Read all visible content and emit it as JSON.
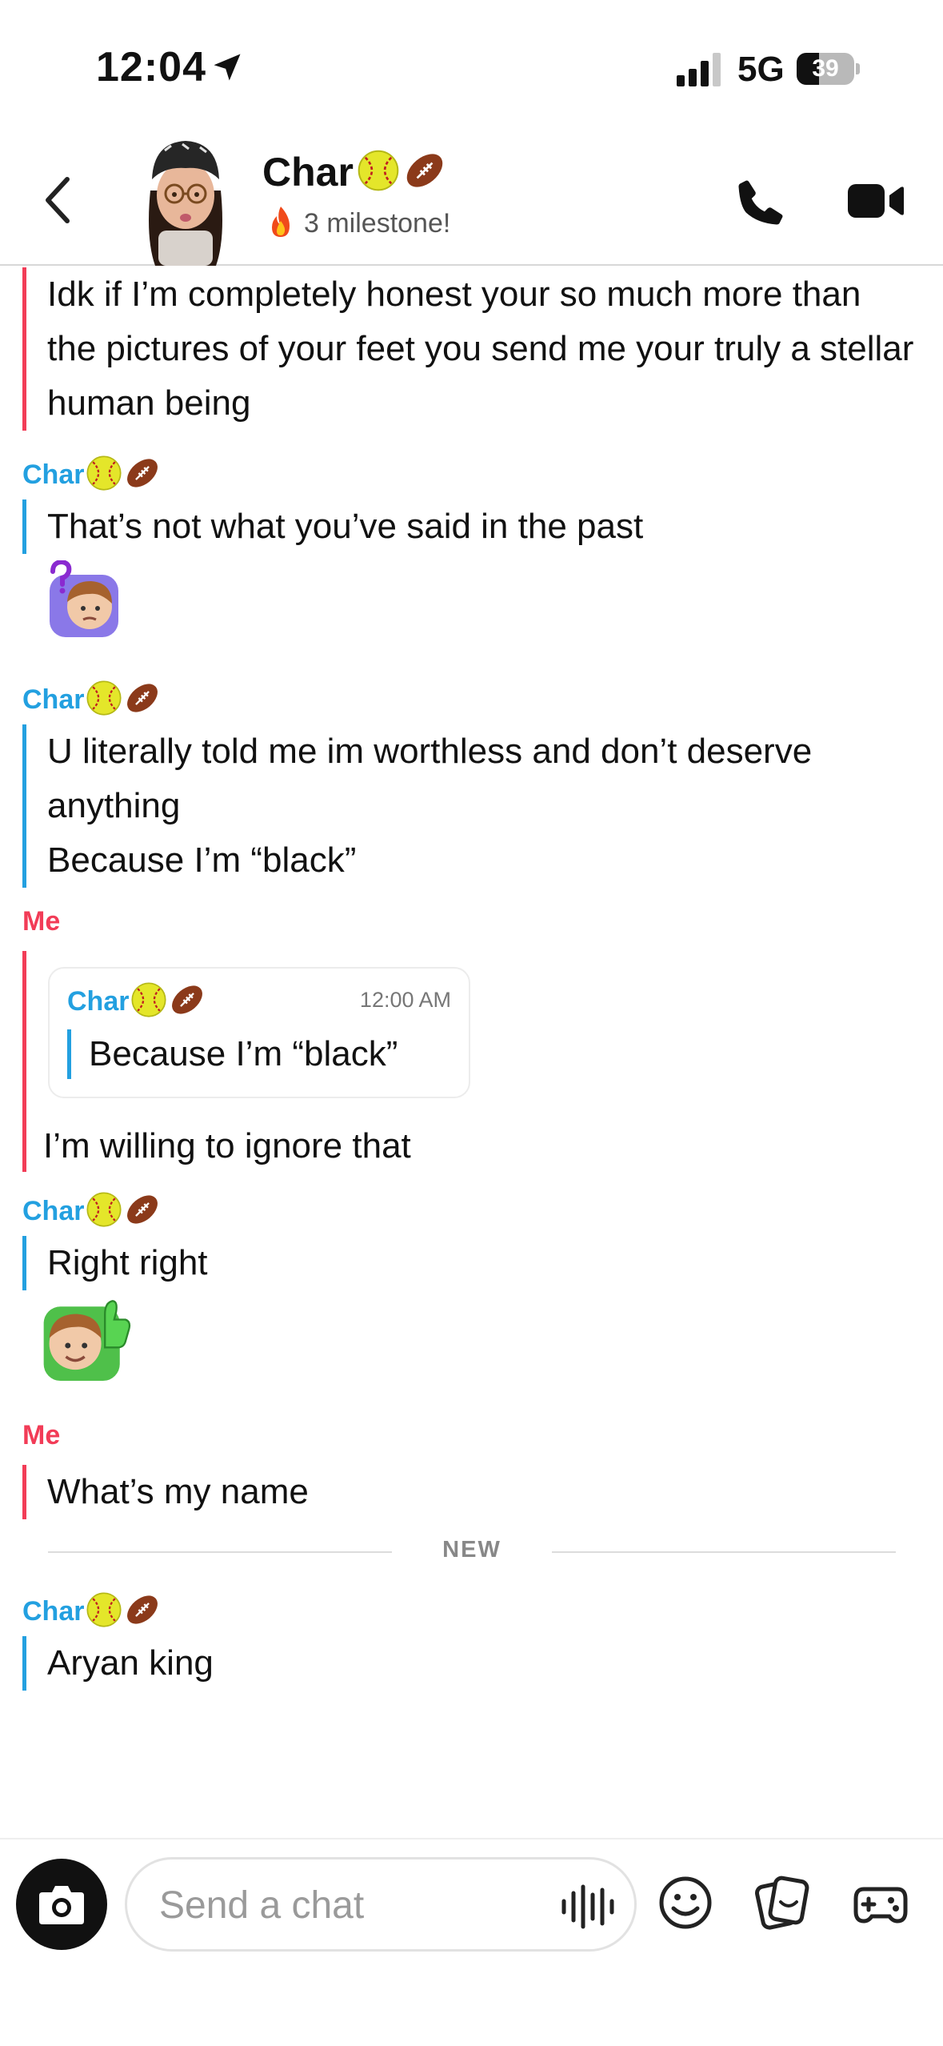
{
  "status_bar": {
    "time": "12:04",
    "network": "5G",
    "battery": "39",
    "battery_level": 0.39
  },
  "header": {
    "name": "Char",
    "name_emojis": [
      "softball-icon",
      "football-icon"
    ],
    "streak": "3 milestone!"
  },
  "messages": [
    {
      "type": "text",
      "from": "me",
      "sender": "",
      "text": "Idk if I’m completely honest your so much more than the pictures of your feet you send me your truly a stellar human being"
    },
    {
      "type": "text",
      "from": "them",
      "sender": "Char",
      "text": "That’s not what you’ve said in the past"
    },
    {
      "type": "sticker",
      "from": "them",
      "sticker": "thinking-bitmoji"
    },
    {
      "type": "text",
      "from": "them",
      "sender": "Char",
      "text": "U literally told me im worthless and don’t deserve anything\nBecause I’m “black”"
    },
    {
      "type": "reply",
      "from": "me",
      "sender": "Me",
      "quote_sender": "Char",
      "quote_time": "12:00 AM",
      "quote_text": "Because I’m “black”",
      "text": "I’m willing to ignore that"
    },
    {
      "type": "text",
      "from": "them",
      "sender": "Char",
      "text": "Right right"
    },
    {
      "type": "sticker",
      "from": "them",
      "sticker": "thumbs-up-bitmoji"
    },
    {
      "type": "text",
      "from": "me",
      "sender": "Me",
      "text": "What’s my name"
    },
    {
      "type": "divider",
      "label": "NEW"
    },
    {
      "type": "text",
      "from": "them",
      "sender": "Char",
      "text": "Aryan king"
    }
  ],
  "composer": {
    "placeholder": "Send a chat"
  },
  "icons": {
    "camera": "camera-icon",
    "mic": "voice-icon",
    "emoji": "smiley-icon",
    "stickers": "sticker-icon",
    "games": "gamepad-icon"
  },
  "colors": {
    "them": "#23a0e0",
    "me": "#f23c57"
  }
}
